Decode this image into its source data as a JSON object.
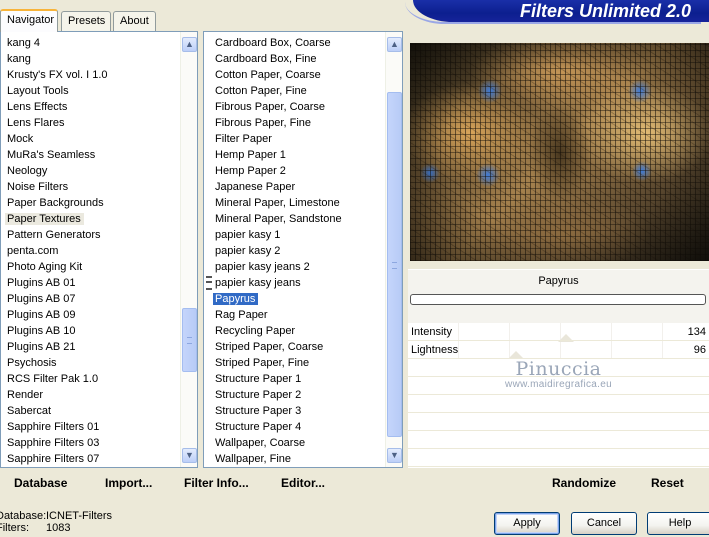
{
  "tabs": [
    {
      "label": "Navigator",
      "active": true
    },
    {
      "label": "Presets",
      "active": false
    },
    {
      "label": "About",
      "active": false
    }
  ],
  "app_title": "Filters Unlimited 2.0",
  "categories": [
    "kang 4",
    "kang",
    "Krusty's FX vol. I 1.0",
    "Layout Tools",
    "Lens Effects",
    "Lens Flares",
    "Mock",
    "MuRa's Seamless",
    "Neology",
    "Noise Filters",
    "Paper Backgrounds",
    "Paper Textures",
    "Pattern Generators",
    "penta.com",
    "Photo Aging Kit",
    "Plugins AB 01",
    "Plugins AB 07",
    "Plugins AB 09",
    "Plugins AB 10",
    "Plugins AB 21",
    "Psychosis",
    "RCS Filter Pak 1.0",
    "Render",
    "Sabercat",
    "Sapphire Filters 01",
    "Sapphire Filters 03",
    "Sapphire Filters 07"
  ],
  "selected_category": "Paper Textures",
  "filters": [
    "Cardboard Box, Coarse",
    "Cardboard Box, Fine",
    "Cotton Paper, Coarse",
    "Cotton Paper, Fine",
    "Fibrous Paper, Coarse",
    "Fibrous Paper, Fine",
    "Filter Paper",
    "Hemp Paper 1",
    "Hemp Paper 2",
    "Japanese Paper",
    "Mineral Paper, Limestone",
    "Mineral Paper, Sandstone",
    "papier kasy 1",
    "papier kasy 2",
    "papier kasy jeans 2",
    "papier kasy jeans",
    "Papyrus",
    "Rag Paper",
    "Recycling Paper",
    "Striped Paper, Coarse",
    "Striped Paper, Fine",
    "Structure Paper 1",
    "Structure Paper 2",
    "Structure Paper 3",
    "Structure Paper 4",
    "Wallpaper, Coarse",
    "Wallpaper, Fine"
  ],
  "selected_filter": "Papyrus",
  "filter_name": "Papyrus",
  "params": [
    {
      "label": "Intensity",
      "value": "134"
    },
    {
      "label": "Lightness",
      "value": "96"
    }
  ],
  "watermark": {
    "name": "Pinuccia",
    "url": "www.maidiregrafica.eu"
  },
  "bottom_links": {
    "database": "Database",
    "import": "Import...",
    "filter_info": "Filter Info...",
    "editor": "Editor...",
    "randomize": "Randomize",
    "reset": "Reset"
  },
  "status": {
    "database_label": "Database:",
    "database_value": "ICNET-Filters",
    "filters_label": "Filters:",
    "filters_value": "1083"
  },
  "buttons": {
    "apply": "Apply",
    "cancel": "Cancel",
    "help": "Help"
  },
  "colors": {
    "title_bar": "#0c1f8f",
    "selection": "#316ac5",
    "tab_accent": "#f8b43a"
  }
}
